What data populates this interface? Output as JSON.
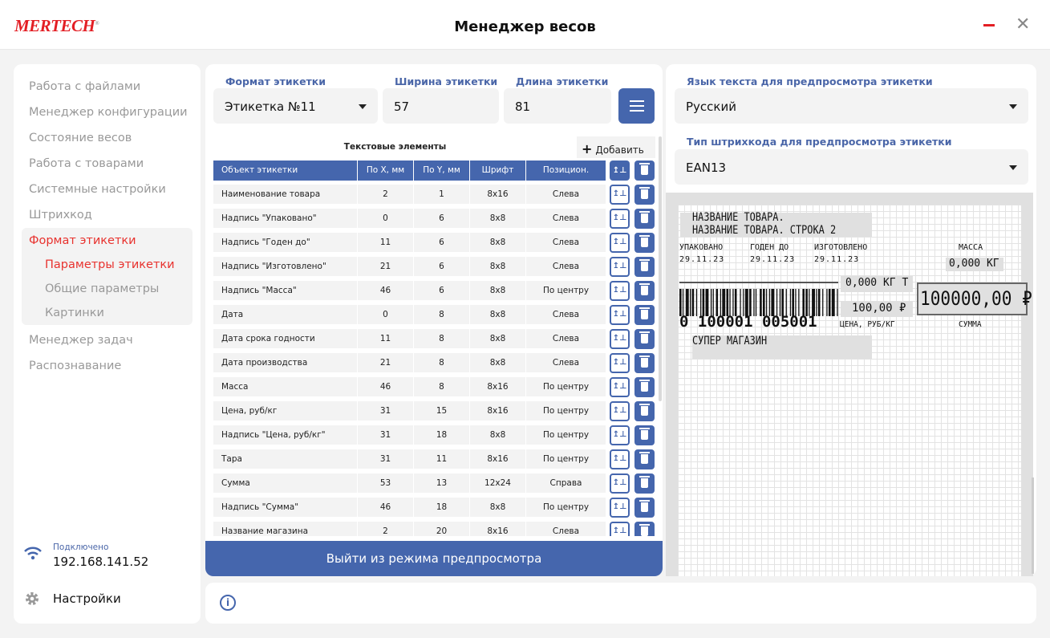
{
  "app": {
    "logo": "MERTECH",
    "title": "Менеджер весов",
    "minimize": "_",
    "close": "✕"
  },
  "sidebar": {
    "items": [
      {
        "label": "Работа с файлами"
      },
      {
        "label": "Менеджер конфигурации"
      },
      {
        "label": "Состояние весов"
      },
      {
        "label": "Работа с товарами"
      },
      {
        "label": "Системные настройки"
      },
      {
        "label": "Штрихкод"
      },
      {
        "label": "Формат этикетки",
        "active": true
      }
    ],
    "subitems": [
      {
        "label": "Параметры этикетки",
        "active": true
      },
      {
        "label": "Общие параметры"
      },
      {
        "label": "Картинки"
      }
    ],
    "items_after": [
      {
        "label": "Менеджер задач"
      },
      {
        "label": "Распознавание"
      }
    ],
    "connection": {
      "status": "Подключено",
      "ip": "192.168.141.52",
      "icon": "wifi-icon"
    },
    "settings": {
      "label": "Настройки",
      "icon": "gear-icon"
    }
  },
  "form": {
    "format_label": "Формат этикетки",
    "format_value": "Этикетка №11",
    "width_label": "Ширина этикетки",
    "width_value": "57",
    "length_label": "Длина этикетки",
    "length_value": "81"
  },
  "table": {
    "title": "Текстовые элементы",
    "add_label": "Добавить",
    "headers": [
      "Объект этикетки",
      "По X, мм",
      "По Y, мм",
      "Шрифт",
      "Позицион."
    ],
    "rows": [
      [
        "Наименование товара",
        "2",
        "1",
        "8x16",
        "Слева"
      ],
      [
        "Надпись \"Упаковано\"",
        "0",
        "6",
        "8x8",
        "Слева"
      ],
      [
        "Надпись \"Годен до\"",
        "11",
        "6",
        "8x8",
        "Слева"
      ],
      [
        "Надпись \"Изготовлено\"",
        "21",
        "6",
        "8x8",
        "Слева"
      ],
      [
        "Надпись \"Масса\"",
        "46",
        "6",
        "8x8",
        "По центру"
      ],
      [
        "Дата",
        "0",
        "8",
        "8x8",
        "Слева"
      ],
      [
        "Дата срока годности",
        "11",
        "8",
        "8x8",
        "Слева"
      ],
      [
        "Дата производства",
        "21",
        "8",
        "8x8",
        "Слева"
      ],
      [
        "Масса",
        "46",
        "8",
        "8x16",
        "По центру"
      ],
      [
        "Цена, руб/кг",
        "31",
        "15",
        "8x16",
        "По центру"
      ],
      [
        "Надпись \"Цена, руб/кг\"",
        "31",
        "18",
        "8x8",
        "По центру"
      ],
      [
        "Тара",
        "31",
        "11",
        "8x16",
        "По центру"
      ],
      [
        "Сумма",
        "53",
        "13",
        "12x24",
        "Справа"
      ],
      [
        "Надпись \"Сумма\"",
        "46",
        "18",
        "8x8",
        "По центру"
      ],
      [
        "Название магазина",
        "2",
        "20",
        "8x16",
        "Слева"
      ]
    ],
    "exit_label": "Выйти из режима предпросмотра"
  },
  "preview": {
    "lang_label": "Язык текста для предпросмотра этикетки",
    "lang_value": "Русский",
    "barcode_label": "Тип штрихкода для предпросмотра этикетки",
    "barcode_value": "EAN13",
    "label": {
      "name1": "НАЗВАНИЕ ТОВАРА.",
      "name2": "НАЗВАНИЕ ТОВАРА. СТРОКА 2",
      "packed": "УПАКОВАНО",
      "best_before": "ГОДЕН ДО",
      "produced": "ИЗГОТОВЛЕНО",
      "mass_label": "МАССА",
      "date1": "29.11.23",
      "date2": "29.11.23",
      "date3": "29.11.23",
      "mass": "0,000 КГ",
      "tare": "0,000 КГ Т",
      "price": "100,00 ₽",
      "sum": "100000,00 ₽",
      "barcode_digits": "0 100001 005001",
      "price_label": "ЦЕНА, РУБ/КГ",
      "sum_label": "СУММА",
      "store": "СУПЕР МАГАЗИН"
    }
  },
  "info_icon": "info-icon"
}
